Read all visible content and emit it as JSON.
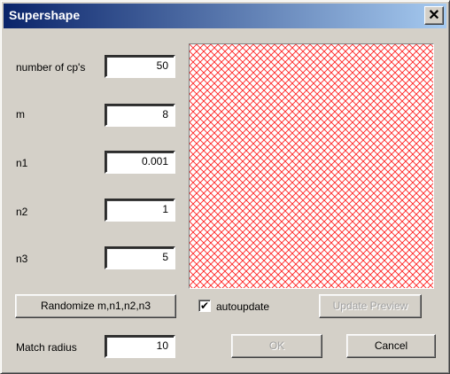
{
  "window": {
    "title": "Supershape",
    "close_glyph": "✕"
  },
  "fields": [
    {
      "label": "number of cp's",
      "value": "50"
    },
    {
      "label": "m",
      "value": "8"
    },
    {
      "label": "n1",
      "value": "0.001"
    },
    {
      "label": "n2",
      "value": "1"
    },
    {
      "label": "n3",
      "value": "5"
    }
  ],
  "randomize_button": "Randomize m,n1,n2,n3",
  "autoupdate": {
    "label": "autoupdate",
    "checked": true,
    "glyph": "✔"
  },
  "update_preview_button": "Update Preview",
  "match_radius": {
    "label": "Match radius",
    "value": "10"
  },
  "ok_button": "OK",
  "cancel_button": "Cancel",
  "preview": {
    "pattern_color": "#ff2020",
    "icon": "crosshatch"
  }
}
